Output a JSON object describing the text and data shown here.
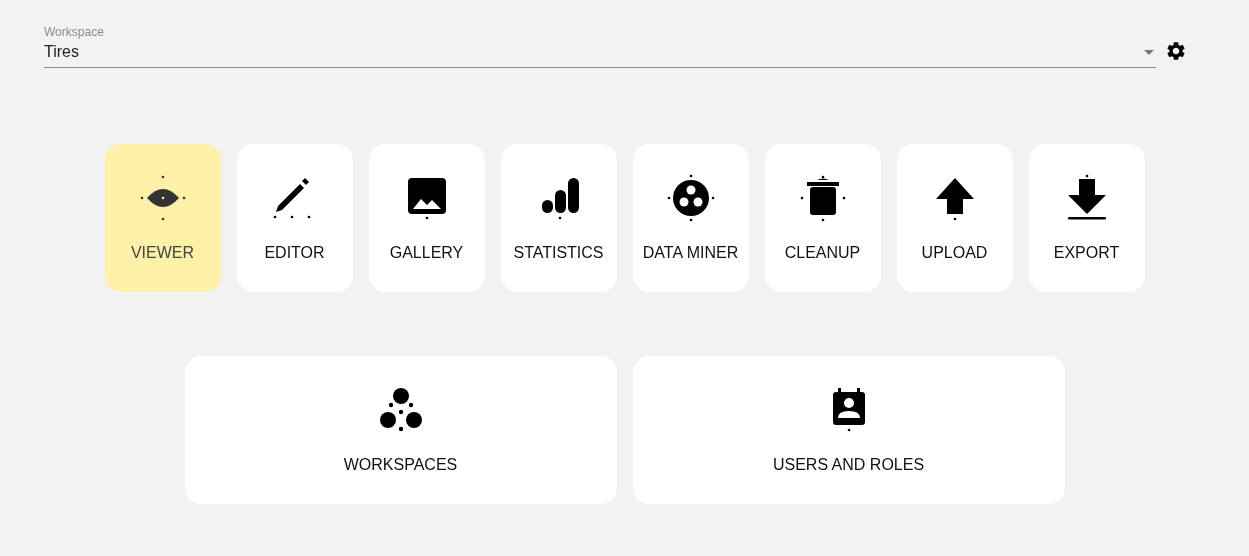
{
  "workspace": {
    "label": "Workspace",
    "value": "Tires"
  },
  "apps": [
    {
      "kind": "viewer",
      "label": "VIEWER",
      "selected": true
    },
    {
      "kind": "editor",
      "label": "EDITOR",
      "selected": false
    },
    {
      "kind": "gallery",
      "label": "GALLERY",
      "selected": false
    },
    {
      "kind": "statistics",
      "label": "STATISTICS",
      "selected": false
    },
    {
      "kind": "miner",
      "label": "DATA MINER",
      "selected": false
    },
    {
      "kind": "cleanup",
      "label": "CLEANUP",
      "selected": false
    },
    {
      "kind": "upload",
      "label": "UPLOAD",
      "selected": false
    },
    {
      "kind": "export",
      "label": "EXPORT",
      "selected": false
    }
  ],
  "admin": [
    {
      "kind": "workspaces",
      "label": "WORKSPACES",
      "selected": false
    },
    {
      "kind": "users",
      "label": "USERS AND ROLES",
      "selected": false
    }
  ]
}
